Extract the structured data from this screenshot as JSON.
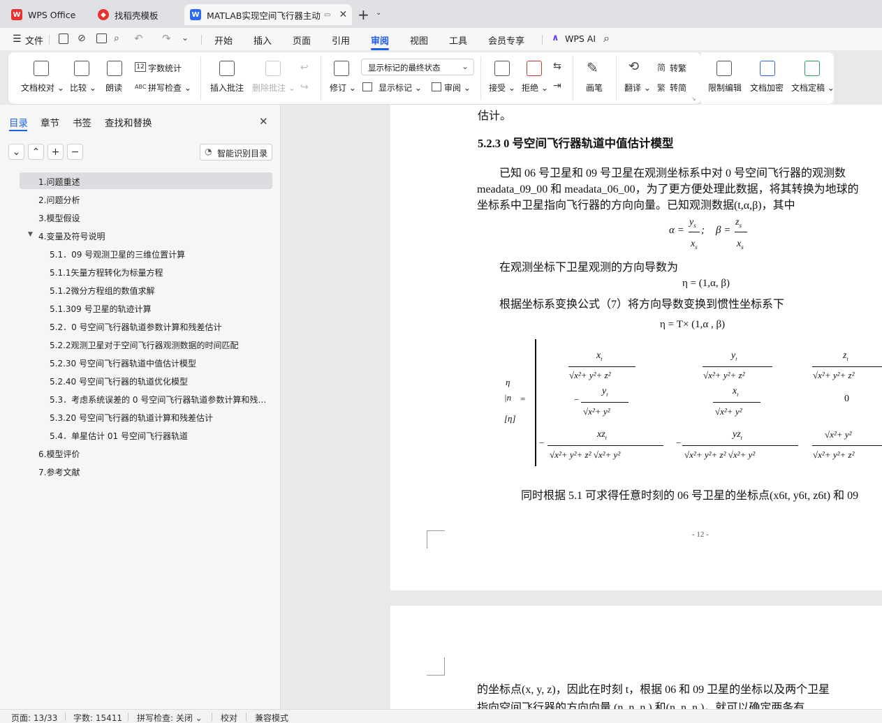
{
  "tabs": [
    {
      "label": "WPS Office"
    },
    {
      "label": "找稻壳模板"
    },
    {
      "label": "MATLAB实现空间飞行器主动"
    }
  ],
  "menu": {
    "file": "文件",
    "items": [
      "开始",
      "插入",
      "页面",
      "引用",
      "审阅",
      "视图",
      "工具",
      "会员专享"
    ],
    "ai": "WPS AI",
    "active": "审阅"
  },
  "ribbon": {
    "doc_check": "文档校对",
    "compare": "比较",
    "read": "朗读",
    "word_count": "字数统计",
    "spell_check": "拼写检查",
    "insert_comment": "插入批注",
    "delete_comment": "删除批注",
    "revise": "修订",
    "markup_state": "显示标记的最终状态",
    "show_markup": "显示标记",
    "review": "审阅",
    "accept": "接受",
    "reject": "拒绝",
    "pen": "画笔",
    "translate": "翻译",
    "to_traditional": "转繁",
    "to_simplified": "转简",
    "restrict_edit": "限制编辑",
    "encrypt": "文档加密",
    "finalize": "文档定稿",
    "wc_icon_text": "12",
    "abc_text": "ABC"
  },
  "sidebar": {
    "tabs": [
      "目录",
      "章节",
      "书签",
      "查找和替换"
    ],
    "smart_toc": "智能识别目录",
    "toc": [
      {
        "label": "1.问题重述",
        "level": 1
      },
      {
        "label": "2.问题分析",
        "level": 1
      },
      {
        "label": "3.模型假设",
        "level": 1
      },
      {
        "label": "4.变量及符号说明",
        "level": 1
      },
      {
        "label": "5.1．09 号观测卫星的三维位置计算",
        "level": 2
      },
      {
        "label": "5.1.1矢量方程转化为标量方程",
        "level": 2
      },
      {
        "label": "5.1.2微分方程组的数值求解",
        "level": 2
      },
      {
        "label": "5.1.309 号卫星的轨迹计算",
        "level": 2
      },
      {
        "label": "5.2．0 号空间飞行器轨道参数计算和残差估计",
        "level": 2
      },
      {
        "label": "5.2.2观测卫星对于空间飞行器观测数据的时间匹配",
        "level": 2
      },
      {
        "label": "5.2.30 号空间飞行器轨道中值估计模型",
        "level": 2
      },
      {
        "label": "5.2.40 号空间飞行器的轨道优化模型",
        "level": 2
      },
      {
        "label": "5.3．考虑系统误差的 0 号空间飞行器轨道参数计算和残差估计",
        "level": 2
      },
      {
        "label": "5.3.20 号空间飞行器的轨道计算和残差估计",
        "level": 2
      },
      {
        "label": "5.4．单星估计 01 号空间飞行器轨道",
        "level": 2
      },
      {
        "label": "6.模型评价",
        "level": 1
      },
      {
        "label": "7.参考文献",
        "level": 1
      }
    ]
  },
  "document": {
    "line_top": "估计。",
    "heading": "5.2.3 0 号空间飞行器轨道中值估计模型",
    "para1_l1": "已知  06 号卫星和  09 号卫星在观测坐标系中对  0 号空间飞行器的观测数",
    "para1_l2": "meadata_09_00 和 meadata_06_00，为了更方便处理此数据，将其转换为地球的",
    "para1_l3": "坐标系中卫星指向飞行器的方向向量。已知观测数据(t,α,β)，其中",
    "alpha_eq": "α =",
    "beta_eq": "β =",
    "para2": "在观测坐标下卫星观测的方向导数为",
    "eta_eq": "η = (1,α, β)",
    "para3": "根据坐标系变换公式（7）将方向导数变换到惯性坐标系下",
    "eta_T": "η = T× (1,α , β)",
    "para4": "同时根据  5.1 可求得任意时刻的  06 号卫星的坐标点(x6t, y6t, z6t) 和  09",
    "page_num": "- 12 -",
    "page2_l1": "的坐标点(x, y, z)，因此在时刻 t，根据  06 和 09 卫星的坐标以及两个卫星",
    "page2_l2": "指向空间飞行器的方向向量  (n ,n ,n ) 和(n ,n ,n )，就可以确定两条有"
  },
  "status": {
    "page": "页面: 13/33",
    "words": "字数: 15411",
    "spell": "拼写检查: 关闭",
    "proof": "校对",
    "compat": "兼容模式"
  }
}
